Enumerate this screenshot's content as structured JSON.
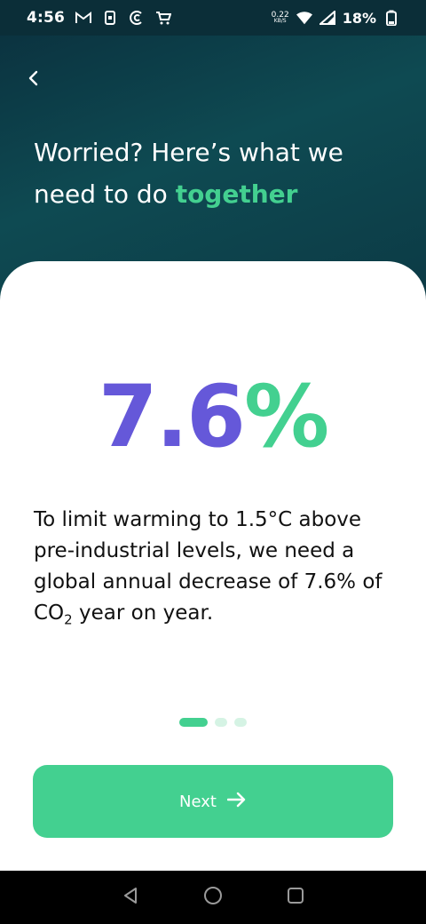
{
  "status_bar": {
    "time": "4:56",
    "net_speed_value": "0.22",
    "net_speed_unit": "KB/S",
    "battery": "18%",
    "notification_icons": [
      "gmail-icon",
      "sim-icon",
      "cred-icon",
      "cart-icon"
    ]
  },
  "header": {
    "headline_prefix": "Worried? Here’s what we need to do ",
    "headline_accent": "together"
  },
  "card": {
    "stat_number": "7.6",
    "stat_unit": "%",
    "description_main": "To limit warming to 1.5°C above pre-industrial levels, we need a global annual decrease of 7.6% of CO",
    "description_sub": "2",
    "description_end": " year on year."
  },
  "pagination": {
    "total": 3,
    "active": 1
  },
  "next_button": {
    "label": "Next"
  },
  "colors": {
    "accent_green": "#43d090",
    "accent_purple": "#6558d9",
    "header_dark": "#0b2e38"
  }
}
